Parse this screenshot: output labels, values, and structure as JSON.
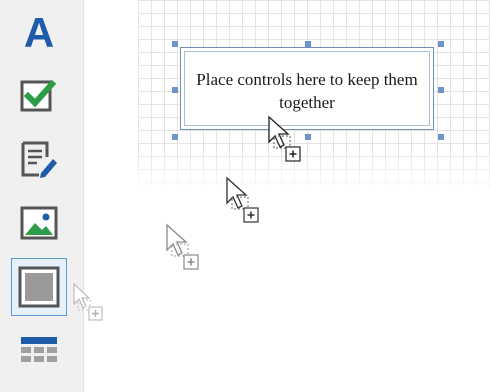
{
  "toolbox": {
    "items": [
      {
        "name": "label-tool",
        "icon": "letter-a-icon",
        "glyph": "A"
      },
      {
        "name": "checkbox-tool",
        "icon": "checkbox-checked-icon"
      },
      {
        "name": "richtext-tool",
        "icon": "edit-document-icon"
      },
      {
        "name": "picture-tool",
        "icon": "picture-icon"
      },
      {
        "name": "panel-tool",
        "icon": "panel-icon",
        "selected": true
      },
      {
        "name": "table-tool",
        "icon": "table-icon"
      }
    ]
  },
  "designer": {
    "panel_text": "Place controls here to keep them together"
  },
  "colors": {
    "accent": "#1e5ba8",
    "check": "#2e9d47",
    "selection_border": "#5a9bd5",
    "handle": "#6d95c9",
    "panel_border": "#6f8fb6"
  }
}
